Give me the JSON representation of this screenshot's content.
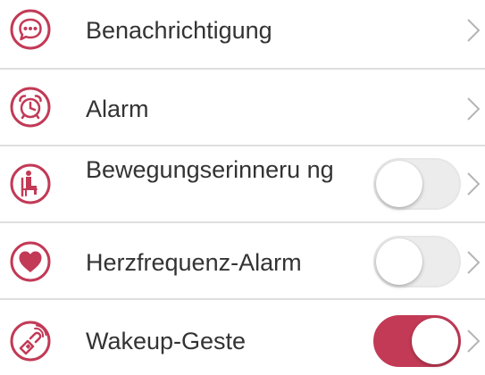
{
  "colors": {
    "accent": "#c23a56",
    "text": "#333333",
    "divider": "#dedede",
    "toggle_off": "#ececec",
    "chevron": "#b5b5b5"
  },
  "settings": {
    "items": [
      {
        "label": "Benachrichtigung",
        "icon": "chat-bubble-icon",
        "has_toggle": false,
        "toggle_on": null
      },
      {
        "label": "Alarm",
        "icon": "alarm-clock-icon",
        "has_toggle": false,
        "toggle_on": null
      },
      {
        "label": "Bewegungserinneru ng",
        "icon": "sitting-person-icon",
        "has_toggle": true,
        "toggle_on": false
      },
      {
        "label": "Herzfrequenz-Alarm",
        "icon": "heart-icon",
        "has_toggle": true,
        "toggle_on": false
      },
      {
        "label": "Wakeup-Geste",
        "icon": "wrist-gesture-icon",
        "has_toggle": true,
        "toggle_on": true
      }
    ]
  }
}
